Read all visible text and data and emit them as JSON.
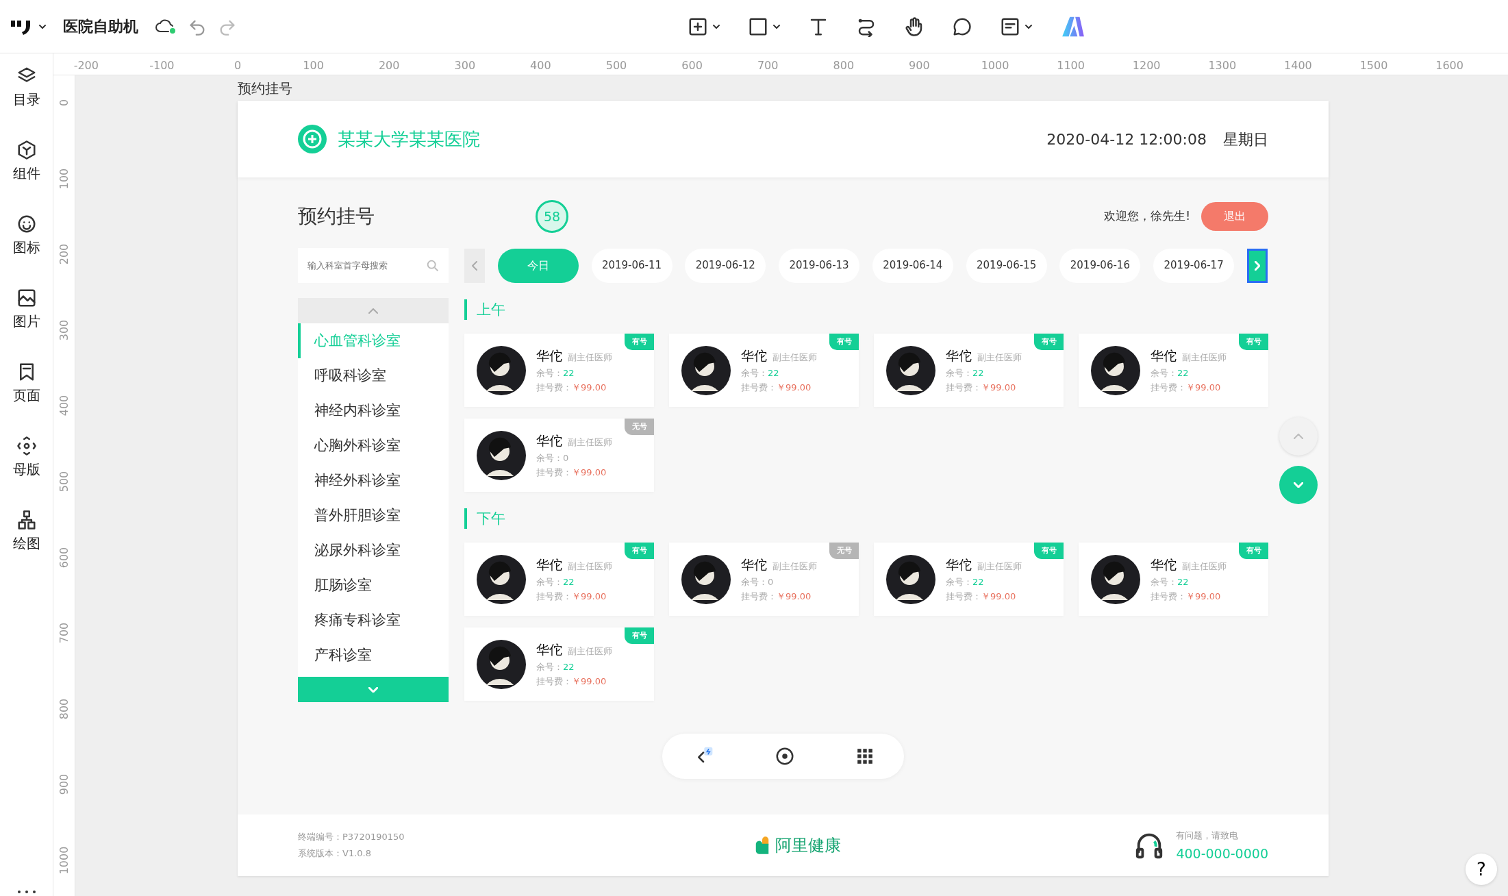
{
  "app": {
    "title": "医院自助机",
    "tools": [
      {
        "kind": "add-page",
        "caret": true
      },
      {
        "kind": "rectangle",
        "caret": true
      },
      {
        "kind": "text",
        "caret": false
      },
      {
        "kind": "connector",
        "caret": false
      },
      {
        "kind": "hand",
        "caret": false
      },
      {
        "kind": "comment",
        "caret": false
      },
      {
        "kind": "note",
        "caret": true
      },
      {
        "kind": "brand",
        "caret": false
      }
    ]
  },
  "rulers": {
    "horizontal": [
      "-200",
      "-100",
      "0",
      "100",
      "200",
      "300",
      "400",
      "500",
      "600",
      "700",
      "800",
      "900",
      "1000",
      "1100",
      "1200",
      "1300",
      "1400",
      "1500",
      "1600"
    ],
    "vertical": [
      "0",
      "100",
      "200",
      "300",
      "400",
      "500",
      "600",
      "700",
      "800",
      "900",
      "1000"
    ]
  },
  "sidebar": {
    "items": [
      {
        "kind": "layers",
        "label": "目录"
      },
      {
        "kind": "cube",
        "label": "组件"
      },
      {
        "kind": "smile",
        "label": "图标"
      },
      {
        "kind": "image",
        "label": "图片"
      },
      {
        "kind": "bookmark",
        "label": "页面"
      },
      {
        "kind": "master",
        "label": "母版"
      },
      {
        "kind": "diagram",
        "label": "绘图"
      }
    ]
  },
  "artboard": {
    "label": "预约挂号",
    "header": {
      "hospital": "某某大学某某医院",
      "datetime": "2020-04-12 12:00:08",
      "weekday": "星期日"
    },
    "page_title": "预约挂号",
    "countdown": "58",
    "welcome": "欢迎您，徐先生!",
    "logout": "退出",
    "search": {
      "placeholder": "输入科室首字母搜索"
    },
    "dates": [
      {
        "label": "今日",
        "selected": true
      },
      {
        "label": "2019-06-11",
        "selected": false
      },
      {
        "label": "2019-06-12",
        "selected": false
      },
      {
        "label": "2019-06-13",
        "selected": false
      },
      {
        "label": "2019-06-14",
        "selected": false
      },
      {
        "label": "2019-06-15",
        "selected": false
      },
      {
        "label": "2019-06-16",
        "selected": false
      },
      {
        "label": "2019-06-17",
        "selected": false
      }
    ],
    "next_highlighted": true,
    "departments": [
      {
        "label": "心血管科诊室",
        "selected": true
      },
      {
        "label": "呼吸科诊室",
        "selected": false
      },
      {
        "label": "神经内科诊室",
        "selected": false
      },
      {
        "label": "心胸外科诊室",
        "selected": false
      },
      {
        "label": "神经外科诊室",
        "selected": false
      },
      {
        "label": "普外肝胆诊室",
        "selected": false
      },
      {
        "label": "泌尿外科诊室",
        "selected": false
      },
      {
        "label": "肛肠诊室",
        "selected": false
      },
      {
        "label": "疼痛专科诊室",
        "selected": false
      },
      {
        "label": "产科诊室",
        "selected": false
      }
    ],
    "sections": [
      {
        "title": "上午",
        "doctors": [
          {
            "name": "华佗",
            "title": "副主任医师",
            "remaining_label": "余号：",
            "remaining": "22",
            "fee_label": "挂号费：",
            "fee": "￥99.00",
            "status": "有号",
            "available": true
          },
          {
            "name": "华佗",
            "title": "副主任医师",
            "remaining_label": "余号：",
            "remaining": "22",
            "fee_label": "挂号费：",
            "fee": "￥99.00",
            "status": "有号",
            "available": true
          },
          {
            "name": "华佗",
            "title": "副主任医师",
            "remaining_label": "余号：",
            "remaining": "22",
            "fee_label": "挂号费：",
            "fee": "￥99.00",
            "status": "有号",
            "available": true
          },
          {
            "name": "华佗",
            "title": "副主任医师",
            "remaining_label": "余号：",
            "remaining": "22",
            "fee_label": "挂号费：",
            "fee": "￥99.00",
            "status": "有号",
            "available": true
          },
          {
            "name": "华佗",
            "title": "副主任医师",
            "remaining_label": "余号：",
            "remaining": "0",
            "fee_label": "挂号费：",
            "fee": "￥99.00",
            "status": "无号",
            "available": false
          }
        ]
      },
      {
        "title": "下午",
        "doctors": [
          {
            "name": "华佗",
            "title": "副主任医师",
            "remaining_label": "余号：",
            "remaining": "22",
            "fee_label": "挂号费：",
            "fee": "￥99.00",
            "status": "有号",
            "available": true
          },
          {
            "name": "华佗",
            "title": "副主任医师",
            "remaining_label": "余号：",
            "remaining": "0",
            "fee_label": "挂号费：",
            "fee": "￥99.00",
            "status": "无号",
            "available": false
          },
          {
            "name": "华佗",
            "title": "副主任医师",
            "remaining_label": "余号：",
            "remaining": "22",
            "fee_label": "挂号费：",
            "fee": "￥99.00",
            "status": "有号",
            "available": true
          },
          {
            "name": "华佗",
            "title": "副主任医师",
            "remaining_label": "余号：",
            "remaining": "22",
            "fee_label": "挂号费：",
            "fee": "￥99.00",
            "status": "有号",
            "available": true
          },
          {
            "name": "华佗",
            "title": "副主任医师",
            "remaining_label": "余号：",
            "remaining": "22",
            "fee_label": "挂号费：",
            "fee": "￥99.00",
            "status": "有号",
            "available": true
          }
        ]
      }
    ],
    "footer": {
      "terminal": "终端编号：P3720190150",
      "version": "系统版本：V1.0.8",
      "brand": "阿里健康",
      "help_text": "有问题，请致电",
      "phone": "400-000-0000"
    }
  },
  "help": "?"
}
